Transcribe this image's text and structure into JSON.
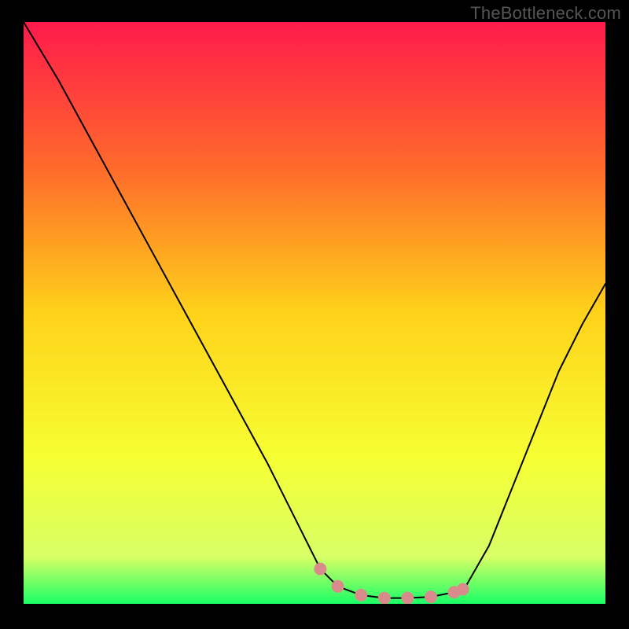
{
  "watermark": "TheBottleneck.com",
  "chart_data": {
    "type": "line",
    "title": "",
    "xlabel": "",
    "ylabel": "",
    "xlim": [
      0,
      100
    ],
    "ylim": [
      0,
      100
    ],
    "grid": false,
    "legend": false,
    "background_gradient": {
      "stops": [
        {
          "offset": 0.0,
          "color": "#ff1a4b"
        },
        {
          "offset": 0.25,
          "color": "#ff6a2b"
        },
        {
          "offset": 0.5,
          "color": "#ffd21a"
        },
        {
          "offset": 0.75,
          "color": "#f6ff33"
        },
        {
          "offset": 0.92,
          "color": "#d7ff66"
        },
        {
          "offset": 1.0,
          "color": "#1aff66"
        }
      ]
    },
    "series": [
      {
        "name": "curve",
        "type": "line",
        "stroke": "#000000",
        "stroke_width": 2,
        "x": [
          0,
          6,
          12,
          18,
          24,
          30,
          36,
          42,
          48,
          51,
          54,
          58,
          62,
          66,
          70,
          74,
          76,
          80,
          84,
          88,
          92,
          96,
          100
        ],
        "mismatch_pct": [
          100,
          90,
          79,
          68,
          57,
          46,
          35,
          24,
          12,
          6,
          3,
          1.5,
          1.0,
          1.0,
          1.2,
          2.0,
          3.0,
          10,
          20,
          30,
          40,
          48,
          55
        ]
      },
      {
        "name": "optimal-markers",
        "type": "scatter",
        "color": "#d98b8b",
        "marker_size": 16,
        "x": [
          51,
          54,
          58,
          62,
          66,
          70,
          74,
          75.5
        ],
        "mismatch_pct": [
          6,
          3,
          1.5,
          1.0,
          1.0,
          1.2,
          2.0,
          2.5
        ]
      }
    ]
  }
}
